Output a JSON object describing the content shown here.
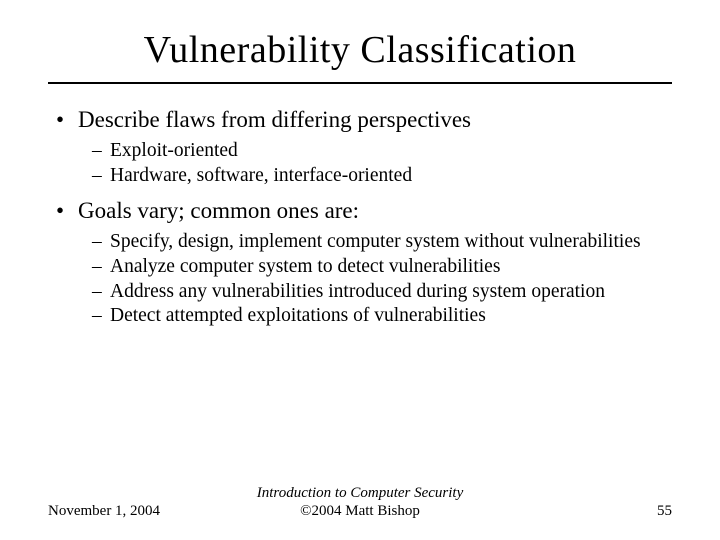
{
  "title": "Vulnerability Classification",
  "bullets": [
    {
      "text": "Describe flaws from differing perspectives",
      "sub": [
        "Exploit-oriented",
        "Hardware, software, interface-oriented"
      ]
    },
    {
      "text": "Goals vary; common ones are:",
      "sub": [
        "Specify, design, implement computer system without vulnerabilities",
        "Analyze computer system to detect vulnerabilities",
        "Address any vulnerabilities introduced during system operation",
        "Detect attempted exploitations of vulnerabilities"
      ]
    }
  ],
  "footer": {
    "date": "November 1, 2004",
    "center_line1": "Introduction to Computer Security",
    "center_line2": "©2004 Matt Bishop",
    "page": "55"
  }
}
